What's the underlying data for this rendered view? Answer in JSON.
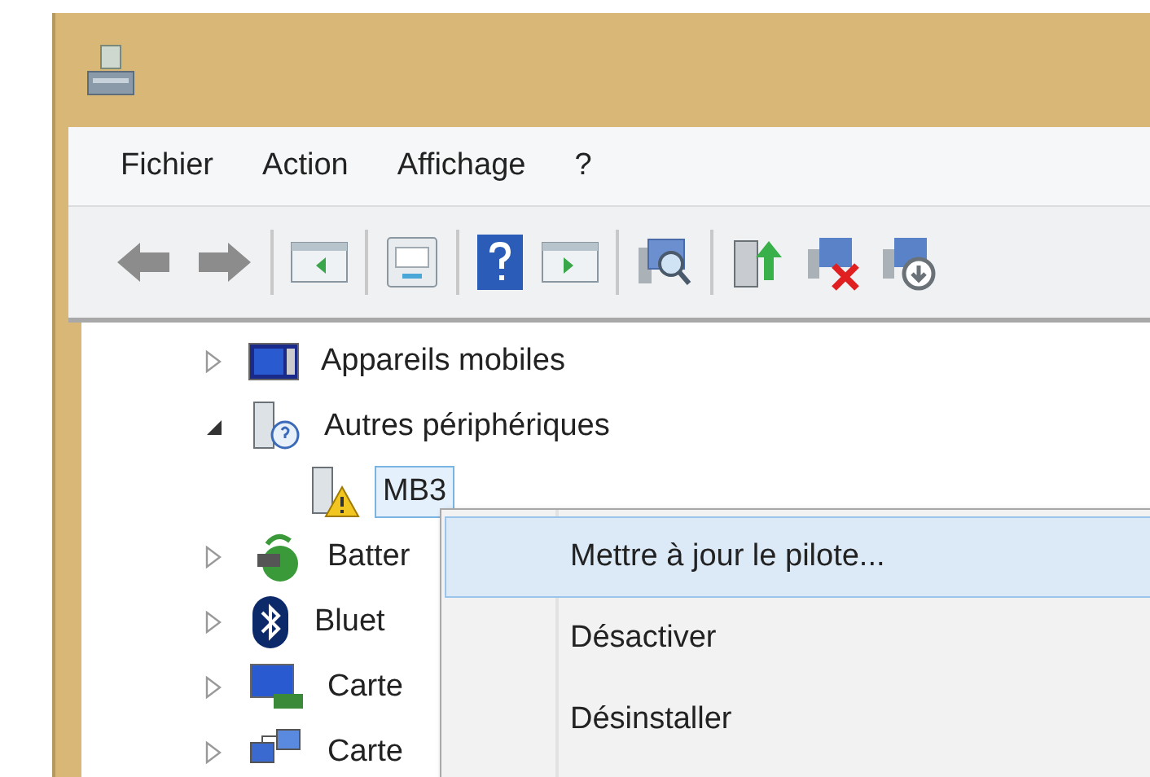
{
  "menu_bar": [
    "Fichier",
    "Action",
    "Affichage",
    "?"
  ],
  "toolbar": [
    {
      "kind": "back"
    },
    {
      "kind": "forward"
    },
    {
      "kind": "separator"
    },
    {
      "kind": "tree"
    },
    {
      "kind": "separator"
    },
    {
      "kind": "properties"
    },
    {
      "kind": "separator"
    },
    {
      "kind": "help"
    },
    {
      "kind": "pane"
    },
    {
      "kind": "separator"
    },
    {
      "kind": "scan"
    },
    {
      "kind": "separator"
    },
    {
      "kind": "update"
    },
    {
      "kind": "disable"
    },
    {
      "kind": "enable"
    }
  ],
  "tree": [
    {
      "label": "Appareils mobiles",
      "kind": "mobile",
      "expanded": false,
      "selected": false
    },
    {
      "label": "Autres périphériques",
      "kind": "other",
      "expanded": true,
      "selected": false,
      "children": [
        {
          "label": "MB3",
          "kind": "warning",
          "selected": true
        }
      ]
    },
    {
      "label": "Batter",
      "kind": "battery",
      "expanded": false,
      "selected": false
    },
    {
      "label": "Bluet",
      "kind": "bluetooth",
      "expanded": false,
      "selected": false
    },
    {
      "label": "Carte",
      "kind": "display",
      "expanded": false,
      "selected": false
    },
    {
      "label": "Carte",
      "kind": "network",
      "expanded": false,
      "selected": false
    }
  ],
  "context_menu": [
    {
      "label": "Mettre à jour le pilote...",
      "selected": true
    },
    {
      "label": "Désactiver",
      "selected": false
    },
    {
      "label": "Désinstaller",
      "selected": false
    }
  ]
}
